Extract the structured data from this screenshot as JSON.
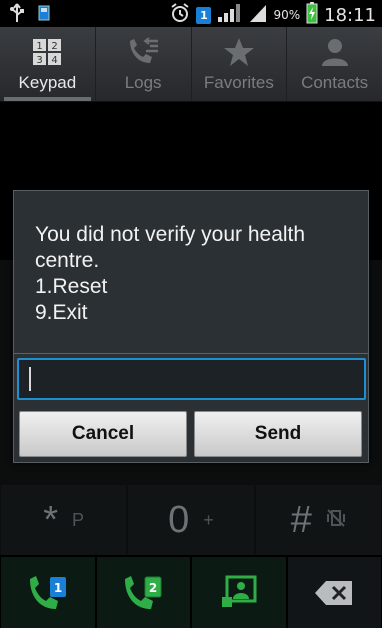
{
  "status_bar": {
    "sim_slot": "1",
    "battery_percent": "90%",
    "time": "18:11",
    "icons": [
      "usb-icon",
      "sd-card-icon",
      "alarm-icon",
      "sim-1-icon",
      "signal-icon",
      "signal-icon",
      "battery-charging-icon"
    ]
  },
  "tabs": [
    {
      "label": "Keypad",
      "icon": "keypad-icon",
      "active": true
    },
    {
      "label": "Logs",
      "icon": "logs-icon",
      "active": false
    },
    {
      "label": "Favorites",
      "icon": "star-icon",
      "active": false
    },
    {
      "label": "Contacts",
      "icon": "contacts-icon",
      "active": false
    }
  ],
  "keypad": {
    "bottom_row": [
      {
        "main": "*",
        "sub": "P"
      },
      {
        "main": "0",
        "sub": "+"
      },
      {
        "main": "#",
        "sub": ""
      }
    ]
  },
  "actions": {
    "call_sim1_badge": "1",
    "call_sim2_badge": "2"
  },
  "dialog": {
    "message": "You did not verify your health centre.\n1.Reset\n9.Exit",
    "input_value": "",
    "cancel_label": "Cancel",
    "send_label": "Send"
  },
  "colors": {
    "accent": "#1e8fd0",
    "call_green": "#2fae48",
    "sim_blue": "#1a7fd6"
  }
}
